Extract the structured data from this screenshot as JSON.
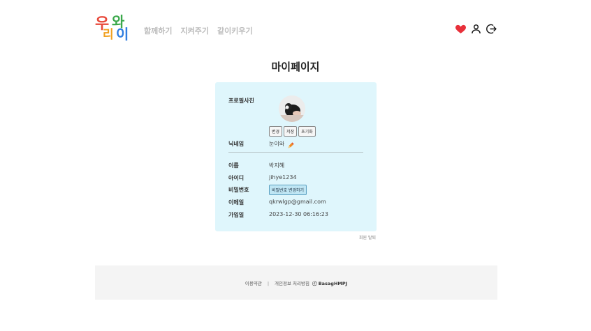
{
  "logo": {
    "chars": [
      "우",
      "리",
      "와",
      "이"
    ],
    "colors": [
      "#e84a3c",
      "#f0a020",
      "#3aa84a",
      "#2f7de0"
    ]
  },
  "nav": {
    "items": [
      "함께하기",
      "지켜주기",
      "같이키우기"
    ]
  },
  "header_icons": {
    "heart": "heart-icon",
    "user": "user-icon",
    "logout": "logout-icon",
    "heart_color": "#e8303a"
  },
  "page": {
    "title": "마이페이지"
  },
  "profile": {
    "photo_label": "프로필사진",
    "photo_buttons": [
      "변경",
      "저장",
      "초기화"
    ],
    "nickname_label": "닉네임",
    "nickname_value": "눈이와",
    "name_label": "이름",
    "name_value": "박지혜",
    "id_label": "아이디",
    "id_value": "jihye1234",
    "password_label": "비밀번호",
    "password_button": "비밀번호 변경하기",
    "email_label": "이메일",
    "email_value": "qkrwlgp@gmail.com",
    "joined_label": "가입일",
    "joined_value": "2023-12-30 06:16:23"
  },
  "withdraw": {
    "label": "회원 탈퇴"
  },
  "footer": {
    "terms": "이용약관",
    "divider": "|",
    "privacy": "개인정보 처리방침",
    "copyright": "ⓒ BasagHMPJ"
  }
}
